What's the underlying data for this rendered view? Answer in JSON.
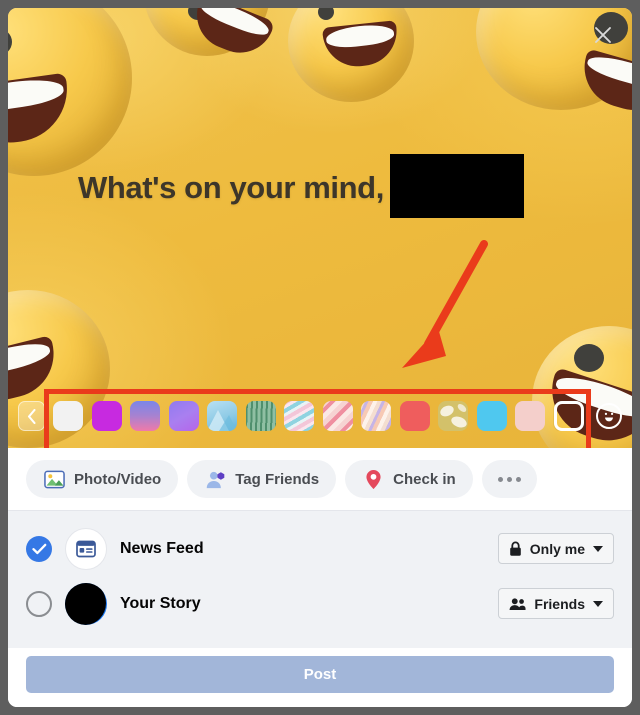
{
  "window": {
    "backdrop_color": "#5e5e5e",
    "card_bg": "#ffffff"
  },
  "composer": {
    "close_label": "×",
    "prompt_text": "What's on your mind,",
    "name_redacted": true,
    "background_color": "#efbe43",
    "text_color": "#3d362a"
  },
  "annotations": {
    "arrow_color": "#ea3b1b",
    "rect_color": "#ea3b1b",
    "arrow_note": "red arrow pointing down-left at the background swatch tray",
    "rect_note": "red rectangle highlighting the background swatch tray"
  },
  "swatch_tray": {
    "prev_label": "‹",
    "emoji_button_name": "emoji-picker",
    "selected_index": 13,
    "swatches": [
      {
        "name": "white",
        "type": "solid",
        "colors": [
          "#f2f2f2"
        ]
      },
      {
        "name": "magenta",
        "type": "solid",
        "colors": [
          "#c72ae0"
        ]
      },
      {
        "name": "blue-pink",
        "type": "gradient",
        "colors": [
          "#7b86e8",
          "#f07aa8"
        ]
      },
      {
        "name": "purple-violet",
        "type": "gradient",
        "colors": [
          "#8f7bf0",
          "#b565ea"
        ]
      },
      {
        "name": "blue-mountain",
        "type": "pattern",
        "colors": [
          "#9fd4ea",
          "#5fb3dd"
        ]
      },
      {
        "name": "green-stripes",
        "type": "pattern",
        "colors": [
          "#8fbfa3",
          "#4f8f6d"
        ]
      },
      {
        "name": "pastel-waves",
        "type": "pattern",
        "colors": [
          "#f3c6d8",
          "#8fd3e0"
        ]
      },
      {
        "name": "pink-blush",
        "type": "pattern",
        "colors": [
          "#f6d3d2",
          "#ef8fa0"
        ]
      },
      {
        "name": "candy-swirl",
        "type": "pattern",
        "colors": [
          "#f4ded0",
          "#c6b4e6"
        ]
      },
      {
        "name": "coral-red",
        "type": "solid",
        "colors": [
          "#ef5d5d"
        ]
      },
      {
        "name": "olive-petals",
        "type": "pattern",
        "colors": [
          "#d3c16a",
          "#f3efe0"
        ]
      },
      {
        "name": "sky-cyan",
        "type": "solid",
        "colors": [
          "#4fc8ef"
        ]
      },
      {
        "name": "pale-pink",
        "type": "solid",
        "colors": [
          "#f4cfcb"
        ]
      },
      {
        "name": "current-yellow",
        "type": "selected",
        "colors": [
          "transparent"
        ]
      },
      {
        "name": "red-texture",
        "type": "pattern",
        "colors": [
          "#ef4a52",
          "#c7323c"
        ]
      }
    ]
  },
  "actions": {
    "items": [
      {
        "label": "Photo/Video",
        "icon": "photo-video-icon"
      },
      {
        "label": "Tag Friends",
        "icon": "tag-friends-icon"
      },
      {
        "label": "Check in",
        "icon": "location-pin-icon"
      }
    ],
    "more_label": "•••"
  },
  "destinations": [
    {
      "label": "News Feed",
      "selected": true,
      "icon": "news-feed-icon",
      "audience": {
        "label": "Only me",
        "icon": "lock-icon"
      }
    },
    {
      "label": "Your Story",
      "selected": false,
      "icon": "profile-avatar",
      "avatar_redacted": true,
      "audience": {
        "label": "Friends",
        "icon": "friends-icon"
      }
    }
  ],
  "post_button": {
    "label": "Post",
    "enabled": false,
    "color": "#a2b6d9"
  }
}
